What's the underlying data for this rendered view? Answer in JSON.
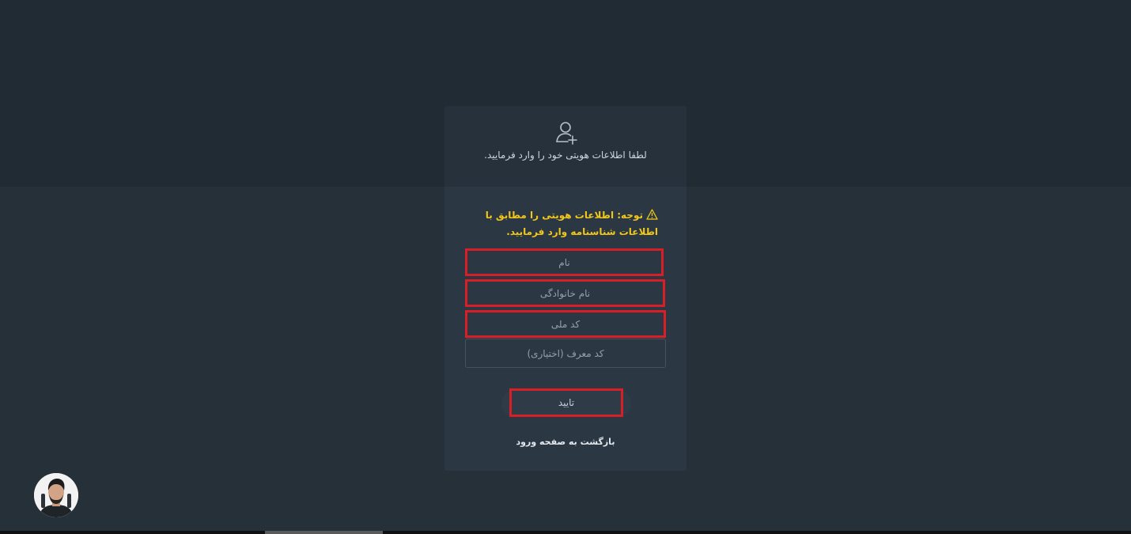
{
  "header": {
    "icon": "user-plus-icon",
    "instruction": "لطفا اطلاعات هویتی خود را وارد فرمایید."
  },
  "warning": {
    "icon": "warning-triangle-icon",
    "text": "توجه: اطلاعات هویتی را مطابق با اطلاعات شناسنامه وارد فرمایید."
  },
  "form": {
    "first_name_placeholder": "نام",
    "last_name_placeholder": "نام خانوادگی",
    "national_code_placeholder": "کد ملی",
    "referral_code_placeholder": "کد معرف (اختیاری)",
    "submit_label": "تایید"
  },
  "links": {
    "back_to_login": "بازگشت به صفحه ورود"
  },
  "colors": {
    "page_background": "#253039",
    "card_background": "#2b3743",
    "warning_text": "#f2c71a",
    "highlight_border": "#d81f26"
  }
}
